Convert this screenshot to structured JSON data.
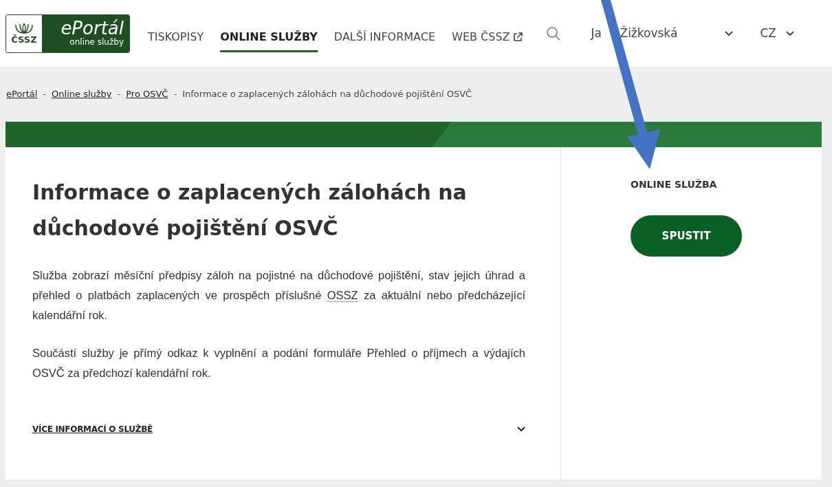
{
  "header": {
    "logo": {
      "mark_text": "ČSSZ",
      "title": "ePortál",
      "subtitle": "online služby"
    },
    "nav": [
      {
        "label": "TISKOPISY",
        "selected": false,
        "kind": "link"
      },
      {
        "label": "ONLINE SLUŽBY",
        "selected": true,
        "kind": "link"
      },
      {
        "label": "DALŠÍ INFORMACE",
        "selected": false,
        "kind": "link"
      },
      {
        "label": "WEB ČSSZ",
        "selected": false,
        "kind": "external"
      }
    ],
    "user_name_parts": [
      "Ja",
      "Žižkovská"
    ],
    "language": "CZ"
  },
  "breadcrumb_separator": "-",
  "breadcrumb": [
    {
      "label": "ePortál",
      "kind": "link"
    },
    {
      "label": "Online služby",
      "kind": "link"
    },
    {
      "label": "Pro OSVČ",
      "kind": "link"
    },
    {
      "label": "Informace o zaplacených zálohách na důchodové pojištění OSVČ",
      "kind": "current"
    }
  ],
  "service": {
    "title": "Informace o zaplacených zálohách na důchodové pojištění OSVČ",
    "paragraphs": [
      "Služba zobrazí měsíční předpisy záloh na pojistné na důchodové pojištění, stav jejich úhrad a přehled o platbách zaplacených ve prospěch příslušné **OSSZ** za aktuální nebo předcházející kalendářní rok.",
      "Součástí služby je přímý odkaz k vyplnění a podání formuláře Přehled o příjmech a výdajích OSVČ za předchozí kalendářní rok."
    ],
    "more_info": {
      "label": "VÍCE INFORMACÍ O SLUŽBĚ",
      "expanded": false
    }
  },
  "sidebar": {
    "heading": "ONLINE SLUŽBA",
    "button": "SPUSTIT"
  }
}
